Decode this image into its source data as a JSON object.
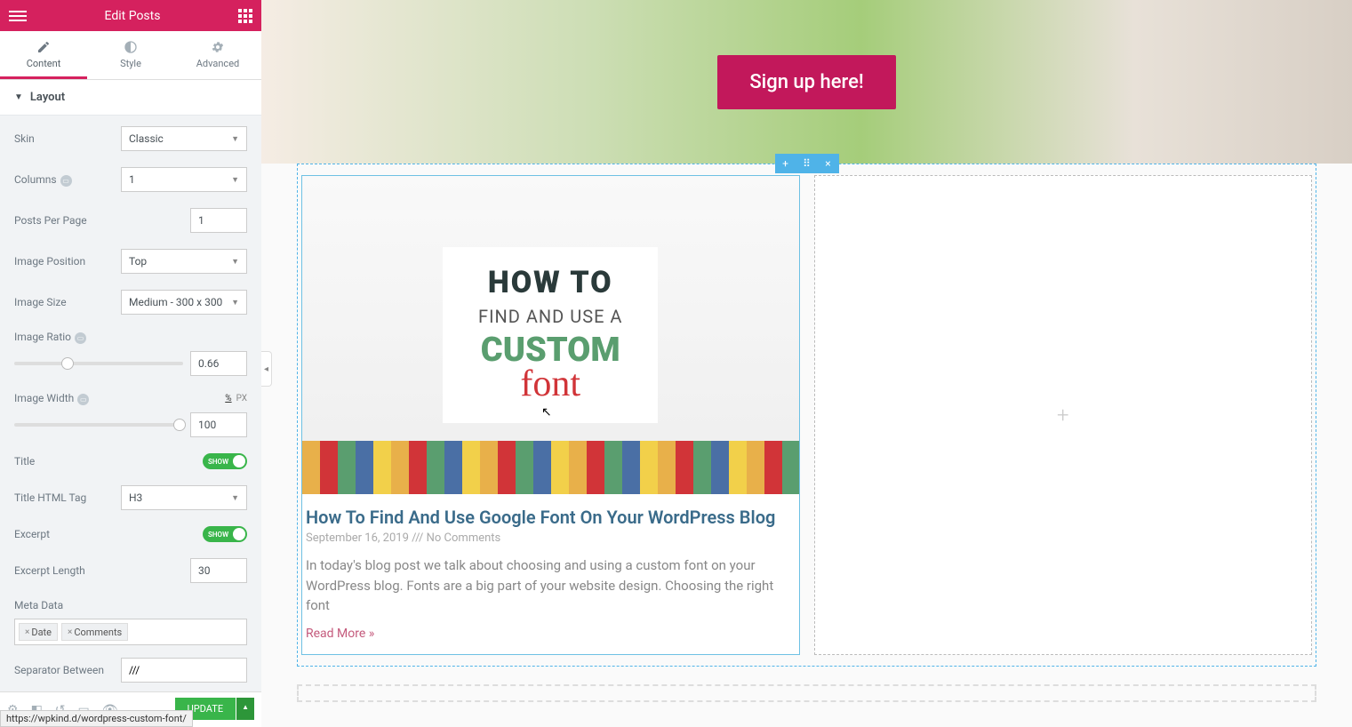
{
  "panel": {
    "title": "Edit Posts",
    "tabs": {
      "content": "Content",
      "style": "Style",
      "advanced": "Advanced"
    },
    "section_layout": "Layout",
    "fields": {
      "skin": {
        "label": "Skin",
        "value": "Classic"
      },
      "columns": {
        "label": "Columns",
        "value": "1"
      },
      "posts_per_page": {
        "label": "Posts Per Page",
        "value": "1"
      },
      "image_position": {
        "label": "Image Position",
        "value": "Top"
      },
      "image_size": {
        "label": "Image Size",
        "value": "Medium - 300 x 300"
      },
      "image_ratio": {
        "label": "Image Ratio",
        "value": "0.66"
      },
      "image_width": {
        "label": "Image Width",
        "value": "100",
        "units": {
          "pct": "%",
          "px": "PX"
        }
      },
      "title": {
        "label": "Title",
        "toggle": "SHOW"
      },
      "title_tag": {
        "label": "Title HTML Tag",
        "value": "H3"
      },
      "excerpt": {
        "label": "Excerpt",
        "toggle": "SHOW"
      },
      "excerpt_length": {
        "label": "Excerpt Length",
        "value": "30"
      },
      "meta_data": {
        "label": "Meta Data",
        "tags": [
          "Date",
          "Comments"
        ]
      },
      "separator": {
        "label": "Separator Between",
        "value": "///"
      }
    },
    "update_btn": "UPDATE"
  },
  "hero": {
    "cta": "Sign up here!"
  },
  "post": {
    "img": {
      "l1": "HOW TO",
      "l2": "FIND AND USE A",
      "l3": "CUSTOM",
      "l4": "font"
    },
    "title": "How To Find And Use Google Font On Your WordPress Blog",
    "date": "September 16, 2019",
    "sep": "///",
    "comments": "No Comments",
    "excerpt": "In today's blog post we talk about choosing and using a custom font on your WordPress blog. Fonts are a big part of your website design. Choosing the right font",
    "read_more": "Read More »"
  },
  "status_url": "https://wpkind.d/wordpress-custom-font/"
}
